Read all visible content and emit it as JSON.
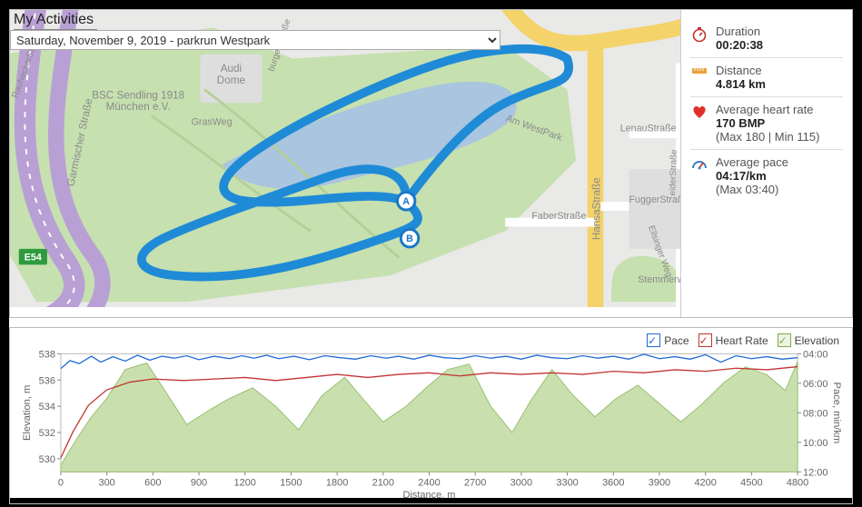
{
  "header": {
    "title": "My Activities",
    "activity_select": "Saturday, November 9, 2019 - parkrun Westpark"
  },
  "map": {
    "labels": {
      "bsc": "BSC Sendling 1918\nMünchen e.V.",
      "audi": "Audi\nDome",
      "grasweg": "GrasWeg",
      "garmischer": "Garmischer Straße",
      "hansa": "HansaStraße",
      "fugger": "FuggerStraße",
      "faber": "FaberStraße",
      "lenau": "LenauStraße",
      "amwestpark": "Am WestPark",
      "stemmer": "Stemmerwiese",
      "rauhecker": "RauheckerStraße",
      "ellsinger": "Ellsinger Weg",
      "eiderstr": "eiderStraße",
      "burger": "burger Straße",
      "e54": "E54"
    },
    "markers": {
      "a": "A",
      "b": "B"
    }
  },
  "stats": {
    "duration": {
      "label": "Duration",
      "value": "00:20:38"
    },
    "distance": {
      "label": "Distance",
      "value": "4.814 km"
    },
    "hr": {
      "label": "Average heart rate",
      "value": "170 BMP",
      "sub": "(Max 180 | Min 115)"
    },
    "pace": {
      "label": "Average pace",
      "value": "04:17/km",
      "sub": "(Max 03:40)"
    }
  },
  "legend": {
    "pace": "Pace",
    "hr": "Heart Rate",
    "elev": "Elevation"
  },
  "chart_axes": {
    "ylabel_left": "Elevation, m",
    "ylabel_right": "Pace, min/km",
    "xlabel": "Distance, m",
    "y_left_ticks": [
      530,
      532,
      534,
      536,
      538
    ],
    "y_right_ticks": [
      "04:00",
      "06:00",
      "08:00",
      "10:00",
      "12:00"
    ],
    "x_ticks": [
      0,
      300,
      600,
      900,
      1200,
      1500,
      1800,
      2100,
      2400,
      2700,
      3000,
      3300,
      3600,
      3900,
      4200,
      4500,
      4800
    ]
  },
  "chart_data": {
    "type": "line",
    "xlabel": "Distance, m",
    "ylabel_left": "Elevation, m",
    "ylabel_right": "Pace, min/km",
    "x_range": [
      0,
      4800
    ],
    "y_elev_range": [
      529,
      538
    ],
    "y_pace_range_sec": [
      240,
      720
    ],
    "series": [
      {
        "name": "Elevation",
        "axis": "left",
        "color": "#a9cf83",
        "fill": true,
        "points": [
          [
            0,
            529.5
          ],
          [
            50,
            530.5
          ],
          [
            120,
            531.8
          ],
          [
            200,
            533.2
          ],
          [
            300,
            534.6
          ],
          [
            420,
            536.8
          ],
          [
            560,
            537.3
          ],
          [
            700,
            534.8
          ],
          [
            820,
            532.6
          ],
          [
            980,
            533.8
          ],
          [
            1100,
            534.6
          ],
          [
            1250,
            535.4
          ],
          [
            1400,
            534.0
          ],
          [
            1550,
            532.2
          ],
          [
            1700,
            534.8
          ],
          [
            1850,
            536.2
          ],
          [
            1980,
            534.4
          ],
          [
            2100,
            532.8
          ],
          [
            2250,
            534.0
          ],
          [
            2380,
            535.4
          ],
          [
            2520,
            536.8
          ],
          [
            2660,
            537.2
          ],
          [
            2800,
            534.0
          ],
          [
            2940,
            532.0
          ],
          [
            3060,
            534.4
          ],
          [
            3200,
            536.8
          ],
          [
            3340,
            534.8
          ],
          [
            3480,
            533.2
          ],
          [
            3620,
            534.6
          ],
          [
            3760,
            535.6
          ],
          [
            3900,
            534.2
          ],
          [
            4040,
            532.8
          ],
          [
            4180,
            534.2
          ],
          [
            4320,
            535.8
          ],
          [
            4460,
            537.0
          ],
          [
            4600,
            536.4
          ],
          [
            4720,
            535.2
          ],
          [
            4800,
            537.4
          ]
        ]
      },
      {
        "name": "Heart Rate",
        "axis": "left_hr",
        "color": "#c23531",
        "hr_range": [
          115,
          180
        ],
        "points": [
          [
            0,
            118
          ],
          [
            80,
            135
          ],
          [
            180,
            152
          ],
          [
            300,
            162
          ],
          [
            450,
            167
          ],
          [
            600,
            169
          ],
          [
            800,
            168
          ],
          [
            1000,
            169
          ],
          [
            1200,
            170
          ],
          [
            1400,
            168
          ],
          [
            1600,
            170
          ],
          [
            1800,
            172
          ],
          [
            2000,
            170
          ],
          [
            2200,
            172
          ],
          [
            2400,
            173
          ],
          [
            2600,
            171
          ],
          [
            2800,
            173
          ],
          [
            3000,
            172
          ],
          [
            3200,
            173
          ],
          [
            3400,
            172
          ],
          [
            3600,
            174
          ],
          [
            3800,
            173
          ],
          [
            4000,
            175
          ],
          [
            4200,
            174
          ],
          [
            4400,
            176
          ],
          [
            4600,
            175
          ],
          [
            4800,
            177
          ]
        ]
      },
      {
        "name": "Pace",
        "axis": "right",
        "color": "#1f6bd6",
        "points": [
          [
            0,
            300
          ],
          [
            60,
            268
          ],
          [
            120,
            280
          ],
          [
            200,
            250
          ],
          [
            260,
            274
          ],
          [
            340,
            252
          ],
          [
            420,
            270
          ],
          [
            500,
            246
          ],
          [
            580,
            266
          ],
          [
            660,
            250
          ],
          [
            740,
            258
          ],
          [
            820,
            248
          ],
          [
            900,
            264
          ],
          [
            1000,
            250
          ],
          [
            1100,
            260
          ],
          [
            1180,
            248
          ],
          [
            1260,
            258
          ],
          [
            1340,
            246
          ],
          [
            1420,
            260
          ],
          [
            1520,
            250
          ],
          [
            1620,
            264
          ],
          [
            1720,
            248
          ],
          [
            1820,
            256
          ],
          [
            1920,
            262
          ],
          [
            2020,
            248
          ],
          [
            2120,
            258
          ],
          [
            2200,
            250
          ],
          [
            2300,
            262
          ],
          [
            2400,
            246
          ],
          [
            2500,
            256
          ],
          [
            2600,
            260
          ],
          [
            2700,
            248
          ],
          [
            2800,
            258
          ],
          [
            2900,
            250
          ],
          [
            3000,
            262
          ],
          [
            3100,
            246
          ],
          [
            3200,
            256
          ],
          [
            3300,
            260
          ],
          [
            3400,
            248
          ],
          [
            3500,
            258
          ],
          [
            3600,
            250
          ],
          [
            3700,
            262
          ],
          [
            3800,
            242
          ],
          [
            3900,
            260
          ],
          [
            4000,
            252
          ],
          [
            4100,
            262
          ],
          [
            4200,
            244
          ],
          [
            4300,
            274
          ],
          [
            4400,
            248
          ],
          [
            4500,
            260
          ],
          [
            4600,
            252
          ],
          [
            4700,
            262
          ],
          [
            4800,
            256
          ]
        ]
      }
    ]
  }
}
